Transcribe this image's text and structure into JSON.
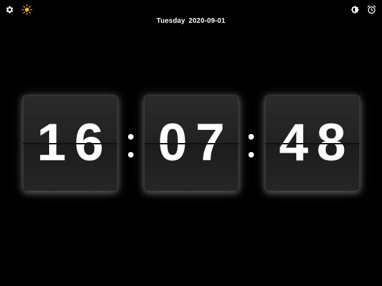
{
  "toolbar": {
    "settings_icon": "gear-icon",
    "brightness_icon": "sun-icon",
    "theme_icon": "contrast-icon",
    "alarm_icon": "alarm-clock-icon",
    "brightness_color": "#f5b71b"
  },
  "date": {
    "weekday": "Tuesday",
    "value": "2020-09-01"
  },
  "clock": {
    "hours": "16",
    "minutes": "07",
    "seconds": "48"
  }
}
